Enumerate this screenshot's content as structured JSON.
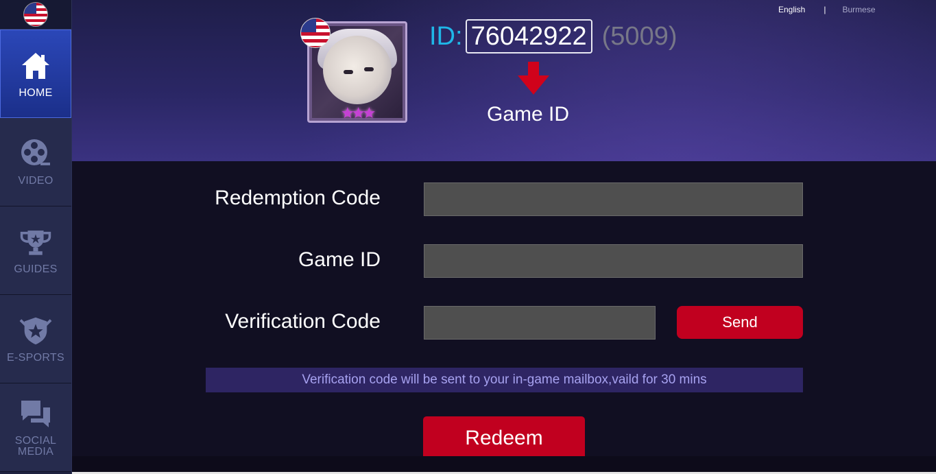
{
  "sidebar": {
    "flag_icon": "us-flag-icon",
    "items": [
      {
        "label": "HOME",
        "icon": "home-icon",
        "active": true
      },
      {
        "label": "VIDEO",
        "icon": "film-reel-icon",
        "active": false
      },
      {
        "label": "GUIDES",
        "icon": "trophy-icon",
        "active": false
      },
      {
        "label": "E-SPORTS",
        "icon": "shield-badge-icon",
        "active": false
      },
      {
        "label": "SOCIAL\nMEDIA",
        "icon": "chat-bubbles-icon",
        "active": false
      }
    ]
  },
  "header": {
    "languages": {
      "english": "English",
      "separator": "|",
      "burmese": "Burmese"
    },
    "id_prefix": "ID:",
    "id_value": "76042922",
    "server": "(5009)",
    "caption": "Game ID"
  },
  "form": {
    "redemption_label": "Redemption Code",
    "redemption_value": "",
    "gameid_label": "Game ID",
    "gameid_value": "",
    "verification_label": "Verification Code",
    "verification_value": "",
    "send_label": "Send",
    "notice": "Verification code will be sent to your in-game mailbox,vaild for 30 mins",
    "redeem_label": "Redeem"
  },
  "colors": {
    "accent_red": "#c1001f",
    "id_blue": "#1fb7e8",
    "sidebar_active": "#2b47b8",
    "notice_bg": "#2e2563",
    "notice_text": "#a7a2f0"
  }
}
